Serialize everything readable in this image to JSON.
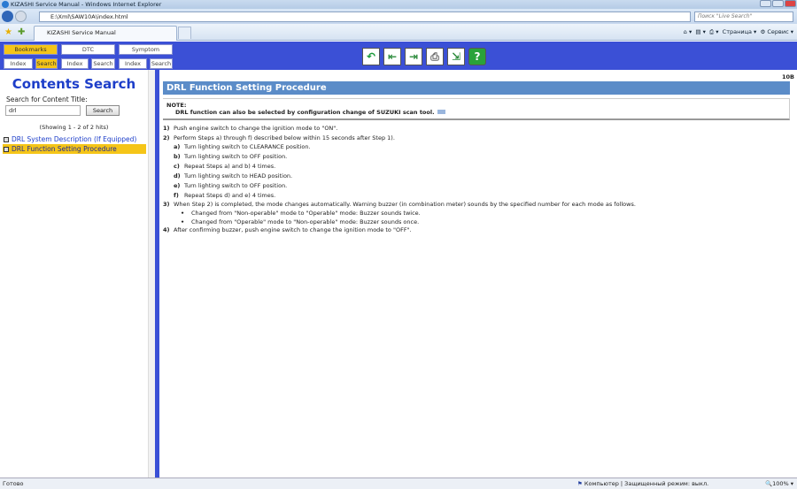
{
  "window": {
    "title": "KIZASHI Service Manual - Windows Internet Explorer",
    "address": "E:\\Xml\\SAW10A\\index.html",
    "search_placeholder": "Поиск \"Live Search\"",
    "tab": "KIZASHI Service Manual",
    "cmd_page": "Страница ▾",
    "cmd_tools": "Сервис ▾"
  },
  "toolbar": {
    "tabs": [
      {
        "label": "Bookmarks",
        "active": true
      },
      {
        "label": "DTC",
        "active": false
      },
      {
        "label": "Symptom",
        "active": false
      }
    ],
    "subtabs": [
      {
        "label": "Index List",
        "active": false
      },
      {
        "label": "Search",
        "active": true
      },
      {
        "label": "Index List",
        "active": false
      },
      {
        "label": "Search",
        "active": false
      },
      {
        "label": "Index List",
        "active": false
      },
      {
        "label": "Search",
        "active": false
      }
    ],
    "icons": [
      "back-icon",
      "previous-page-icon",
      "next-page-icon",
      "print-icon",
      "export-icon",
      "help-icon"
    ]
  },
  "sidebar": {
    "title": "Contents Search",
    "label": "Search for Content Title:",
    "query": "drl",
    "search_button": "Search",
    "count": "(Showing 1 - 2 of 2 hits)",
    "results": [
      {
        "label": "DRL System Description (If Equipped)",
        "selected": false
      },
      {
        "label": "DRL Function Setting Procedure",
        "selected": true
      }
    ]
  },
  "content": {
    "section_code": "10B",
    "title": "DRL Function Setting Procedure",
    "note_label": "NOTE:",
    "note_text": "DRL function can also be selected by configuration change of SUZUKI scan tool.",
    "steps": [
      {
        "num": "1)",
        "text": "Push engine switch to change the ignition mode to \"ON\"."
      },
      {
        "num": "2)",
        "text": "Perform Steps a) through f) described below within 15 seconds after Step 1)."
      },
      {
        "num": "a)",
        "text": "Turn lighting switch to CLEARANCE position."
      },
      {
        "num": "b)",
        "text": "Turn lighting switch to OFF position."
      },
      {
        "num": "c)",
        "text": "Repeat Steps a) and b) 4 times."
      },
      {
        "num": "d)",
        "text": "Turn lighting switch to HEAD position."
      },
      {
        "num": "e)",
        "text": "Turn lighting switch to OFF position."
      },
      {
        "num": "f)",
        "text": "Repeat Steps d) and e) 4 times."
      },
      {
        "num": "3)",
        "text": "When Step 2) is completed, the mode changes automatically. Warning buzzer (in combination meter) sounds by the specified number for each mode as follows."
      },
      {
        "num": "•",
        "text": "Changed from \"Non-operable\" mode to \"Operable\" mode: Buzzer sounds twice."
      },
      {
        "num": "•",
        "text": "Changed from \"Operable\" mode to \"Non-operable\" mode: Buzzer sounds once."
      },
      {
        "num": "4)",
        "text": "After confirming buzzer, push engine switch to change the ignition mode to \"OFF\"."
      }
    ]
  },
  "status": {
    "left": "Готово",
    "zone": "Компьютер | Защищенный режим: выкл.",
    "zoom": "100%"
  }
}
